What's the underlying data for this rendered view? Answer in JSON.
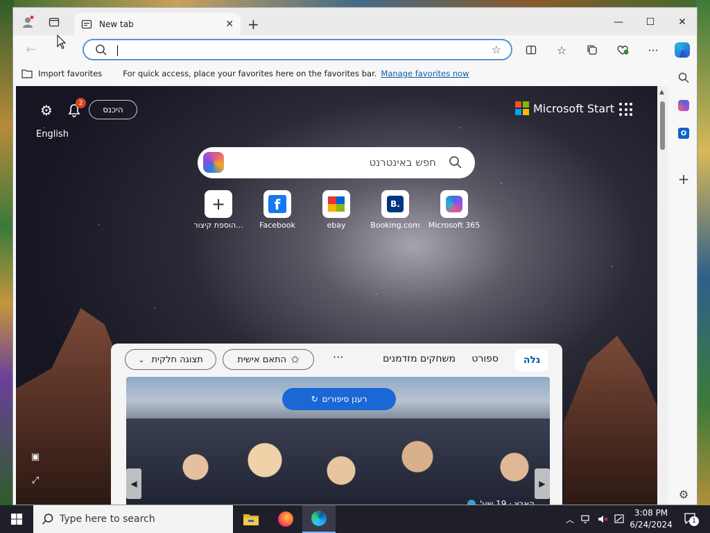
{
  "browser": {
    "tab_title": "New tab",
    "address_value": "",
    "favorites_bar": {
      "import_label": "Import favorites",
      "hint_text": "For quick access, place your favorites here on the favorites bar.",
      "manage_link": "Manage favorites now"
    }
  },
  "newtab": {
    "signin_label": "היכנס",
    "notifications_count": "2",
    "language_label": "English",
    "brand_label": "Microsoft Start",
    "search_placeholder": "חפש באינטרנט",
    "quick_links": [
      {
        "label": "הוספת קיצור...",
        "icon": "plus-icon"
      },
      {
        "label": "Facebook",
        "icon": "facebook-icon"
      },
      {
        "label": "ebay",
        "icon": "ebay-icon"
      },
      {
        "label": "Booking.com",
        "icon": "booking-icon"
      },
      {
        "label": "Microsoft 365",
        "icon": "microsoft365-icon"
      }
    ],
    "feed": {
      "tabs": [
        "גלה",
        "ספורט",
        "משחקים מזדמנים"
      ],
      "active_tab": "גלה",
      "more_label": "···",
      "personalize_label": "התאם אישית",
      "view_label": "תצוגה חלקית",
      "refresh_label": "רענן סיפורים",
      "story_source": "הארץ · 19 שע'"
    }
  },
  "taskbar": {
    "search_placeholder": "Type here to search",
    "time": "3:08 PM",
    "date": "6/24/2024",
    "notification_count": "1"
  },
  "colors": {
    "accent": "#1a67d6",
    "address_border": "#5a8fd6",
    "badge_red": "#d8431f",
    "taskbar": "#1f1f2a"
  }
}
